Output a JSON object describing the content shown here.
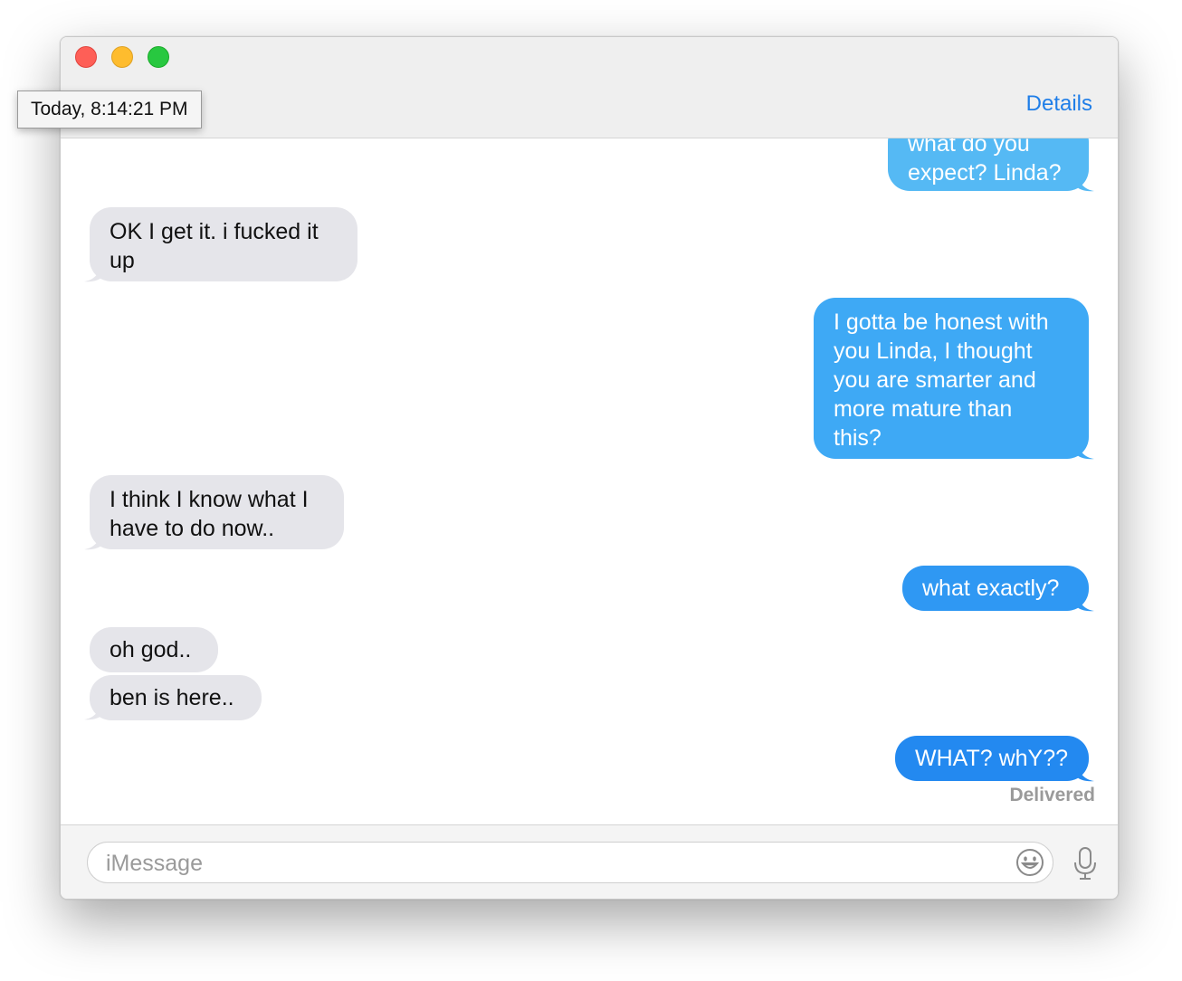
{
  "window": {
    "details_label": "Details",
    "tooltip": "Today, 8:14:21 PM"
  },
  "colors": {
    "incoming": "#e5e5ea",
    "outgoing_light": "#55b9f4",
    "outgoing_mid": "#3aa5f5",
    "outgoing_dark": "#2389f0",
    "link": "#1f7ee8"
  },
  "messages": [
    {
      "side": "out",
      "text": "what do you\nexpect? Linda?"
    },
    {
      "side": "in",
      "text": "OK I get it. i fucked it\nup"
    },
    {
      "side": "out",
      "text": "I gotta be honest with\nyou Linda, I thought\nyou are smarter and\nmore mature than\nthis?"
    },
    {
      "side": "in",
      "text": "I think I know what I\nhave to do now.."
    },
    {
      "side": "out",
      "text": "what exactly?"
    },
    {
      "side": "in",
      "text": "oh god.."
    },
    {
      "side": "in",
      "text": "ben is here.."
    },
    {
      "side": "out",
      "text": "WHAT? whY??"
    }
  ],
  "status": {
    "delivered": "Delivered"
  },
  "composer": {
    "placeholder": "iMessage",
    "emoji_icon": "emoji-smile-icon",
    "mic_icon": "microphone-icon"
  }
}
